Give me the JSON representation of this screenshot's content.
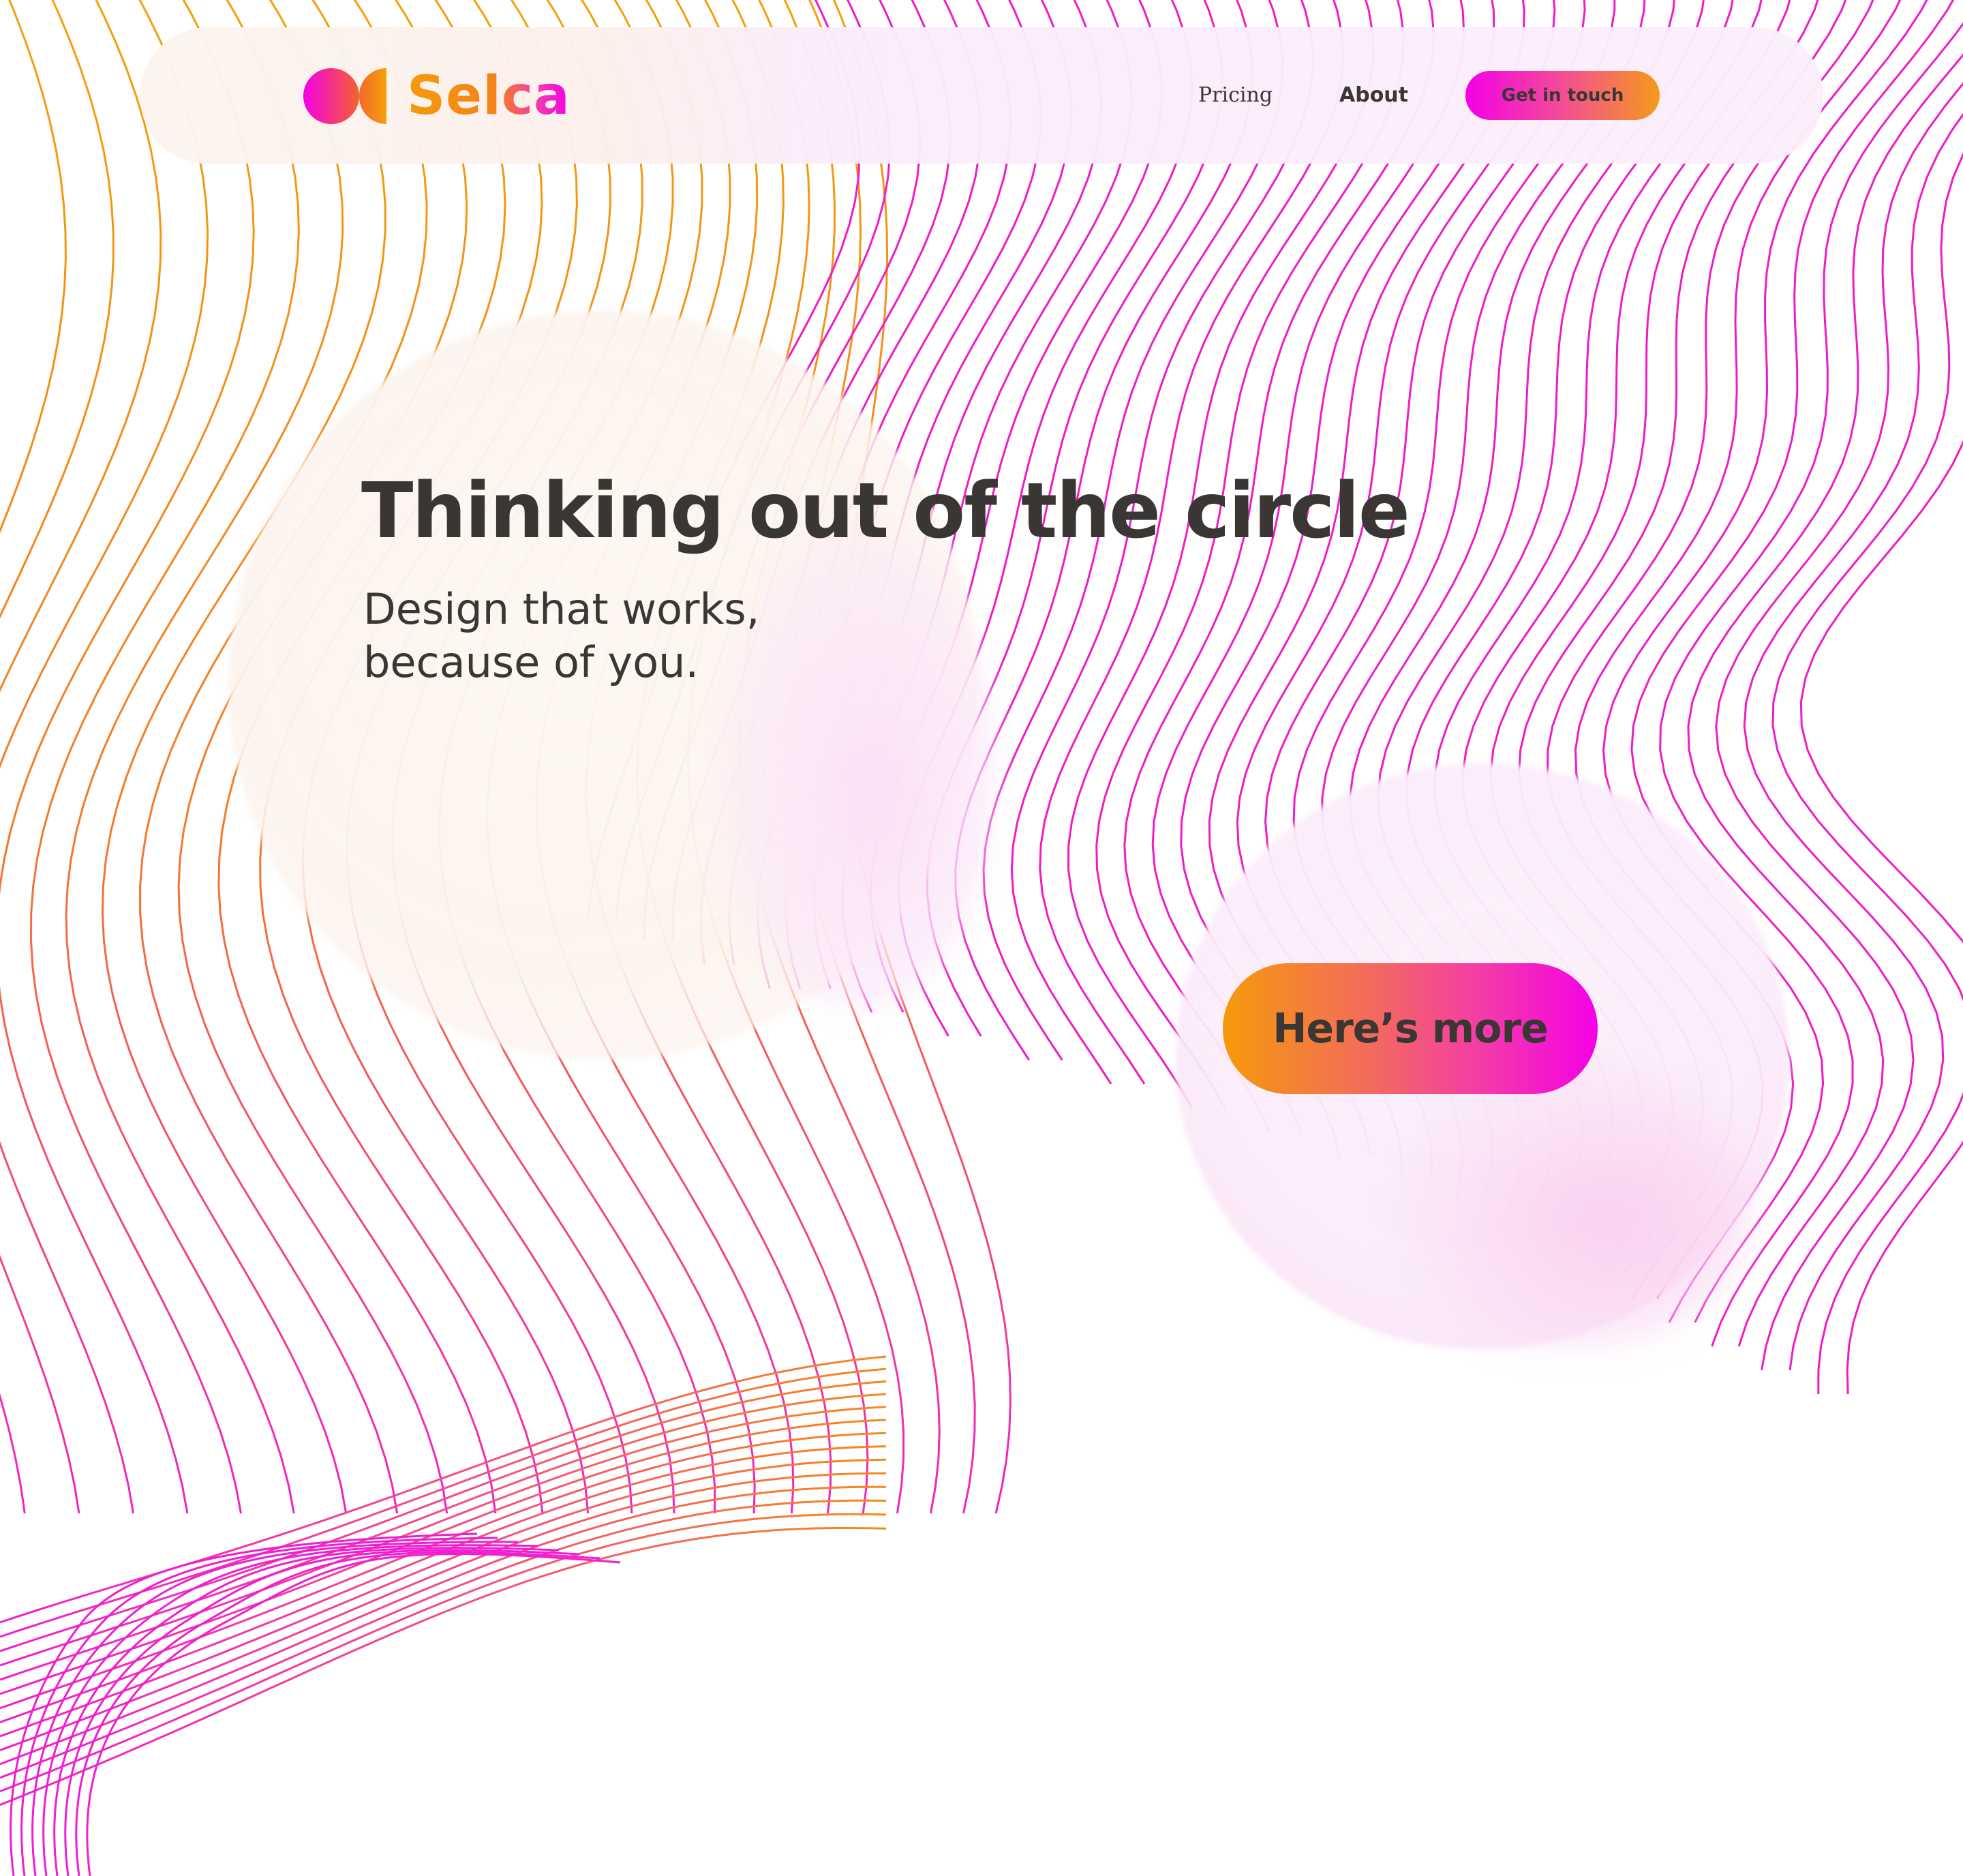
{
  "brand": {
    "name": "Selca",
    "logo_icon": "selca-logo-mark"
  },
  "nav": {
    "items": [
      {
        "label": "Pricing"
      },
      {
        "label": "About"
      }
    ],
    "cta_label": "Get in touch"
  },
  "hero": {
    "title": "Thinking out of the circle",
    "subtitle_lines": [
      "Design that works,",
      "because of you."
    ],
    "cta_label": "Here’s more"
  },
  "colors": {
    "text": "#3a3634",
    "orange": "#f59a0c",
    "magenta": "#f400e6",
    "coral": "#f26a2a"
  }
}
